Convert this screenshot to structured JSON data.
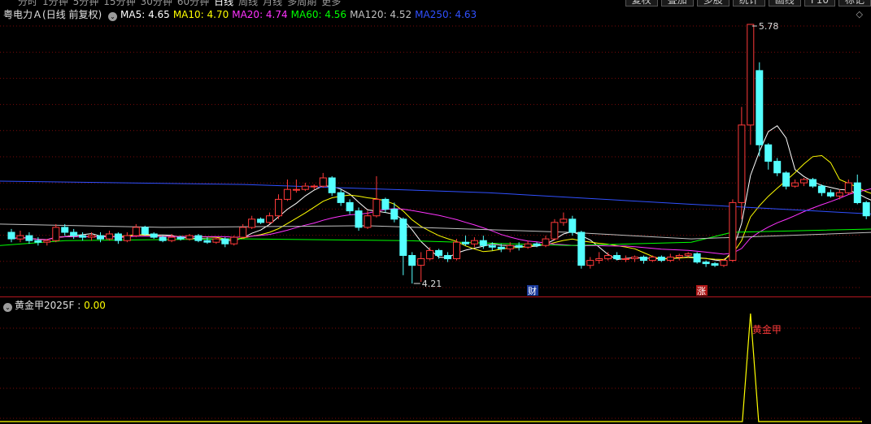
{
  "toolbar": {
    "periods": [
      "分时",
      "1分钟",
      "5分钟",
      "15分钟",
      "30分钟",
      "60分钟",
      "日线",
      "周线",
      "月线",
      "多周期",
      "更多"
    ],
    "buttons": [
      "复权",
      "叠加",
      "多股",
      "统计",
      "画线",
      "F10",
      "标记"
    ]
  },
  "header": {
    "stock_name": "粤电力Ａ",
    "mode": "(日线 前复权)",
    "dropdown_glyph": "⌄",
    "settings_glyph": "◇",
    "ma": [
      {
        "label": "MA5: ",
        "value": "4.65",
        "color": "#ffffff"
      },
      {
        "label": "MA10: ",
        "value": "4.70",
        "color": "#ffff00"
      },
      {
        "label": "MA20: ",
        "value": "4.74",
        "color": "#ff33ff"
      },
      {
        "label": "MA60: ",
        "value": "4.56",
        "color": "#00ff00"
      },
      {
        "label": "MA120: ",
        "value": "4.52",
        "color": "#c0c0c0"
      },
      {
        "label": "MA250: ",
        "value": "4.63",
        "color": "#3050ff"
      }
    ]
  },
  "annotations": {
    "high_label": "5.78",
    "low_label": "4.21",
    "event_cai": "财",
    "event_zhang": "涨"
  },
  "indicator": {
    "dropdown_glyph": "⌄",
    "name": "黄金甲2025F",
    "sep": " : ",
    "value": "0.00",
    "signal_label": "黄金甲"
  },
  "chart_data": {
    "type": "candlestick",
    "price_range": [
      4.21,
      5.78
    ],
    "up_color": "#ff3a3a",
    "down_color": "#54ffff",
    "candles": [
      [
        4.52,
        4.48,
        4.54,
        4.46
      ],
      [
        4.48,
        4.5,
        4.53,
        4.46
      ],
      [
        4.5,
        4.47,
        4.52,
        4.45
      ],
      [
        4.47,
        4.46,
        4.49,
        4.44
      ],
      [
        4.46,
        4.47,
        4.48,
        4.44
      ],
      [
        4.47,
        4.55,
        4.57,
        4.46
      ],
      [
        4.55,
        4.52,
        4.57,
        4.5
      ],
      [
        4.52,
        4.5,
        4.54,
        4.48
      ],
      [
        4.5,
        4.49,
        4.52,
        4.47
      ],
      [
        4.49,
        4.5,
        4.52,
        4.47
      ],
      [
        4.5,
        4.48,
        4.52,
        4.46
      ],
      [
        4.48,
        4.51,
        4.53,
        4.47
      ],
      [
        4.51,
        4.47,
        4.52,
        4.45
      ],
      [
        4.47,
        4.5,
        4.52,
        4.46
      ],
      [
        4.5,
        4.55,
        4.57,
        4.49
      ],
      [
        4.55,
        4.51,
        4.56,
        4.5
      ],
      [
        4.51,
        4.49,
        4.52,
        4.48
      ],
      [
        4.49,
        4.47,
        4.5,
        4.46
      ],
      [
        4.47,
        4.49,
        4.51,
        4.46
      ],
      [
        4.49,
        4.48,
        4.5,
        4.47
      ],
      [
        4.48,
        4.5,
        4.51,
        4.47
      ],
      [
        4.5,
        4.47,
        4.51,
        4.46
      ],
      [
        4.47,
        4.46,
        4.49,
        4.45
      ],
      [
        4.46,
        4.48,
        4.49,
        4.45
      ],
      [
        4.48,
        4.45,
        4.49,
        4.43
      ],
      [
        4.45,
        4.49,
        4.5,
        4.44
      ],
      [
        4.49,
        4.55,
        4.57,
        4.48
      ],
      [
        4.55,
        4.6,
        4.62,
        4.54
      ],
      [
        4.6,
        4.58,
        4.61,
        4.57
      ],
      [
        4.58,
        4.62,
        4.64,
        4.57
      ],
      [
        4.62,
        4.72,
        4.75,
        4.6
      ],
      [
        4.72,
        4.78,
        4.84,
        4.71
      ],
      [
        4.78,
        4.78,
        4.84,
        4.76
      ],
      [
        4.78,
        4.8,
        4.82,
        4.77
      ],
      [
        4.8,
        4.8,
        4.81,
        4.78
      ],
      [
        4.8,
        4.85,
        4.88,
        4.79
      ],
      [
        4.85,
        4.76,
        4.86,
        4.74
      ],
      [
        4.76,
        4.7,
        4.78,
        4.68
      ],
      [
        4.7,
        4.65,
        4.72,
        4.63
      ],
      [
        4.65,
        4.55,
        4.67,
        4.53
      ],
      [
        4.55,
        4.62,
        4.65,
        4.54
      ],
      [
        4.62,
        4.72,
        4.86,
        4.61
      ],
      [
        4.72,
        4.66,
        4.73,
        4.64
      ],
      [
        4.66,
        4.6,
        4.7,
        4.58
      ],
      [
        4.6,
        4.38,
        4.61,
        4.26
      ],
      [
        4.38,
        4.32,
        4.4,
        4.21
      ],
      [
        4.32,
        4.36,
        4.4,
        4.22
      ],
      [
        4.36,
        4.41,
        4.43,
        4.35
      ],
      [
        4.41,
        4.38,
        4.42,
        4.36
      ],
      [
        4.38,
        4.36,
        4.4,
        4.34
      ],
      [
        4.36,
        4.46,
        4.48,
        4.35
      ],
      [
        4.46,
        4.45,
        4.5,
        4.44
      ],
      [
        4.45,
        4.47,
        4.49,
        4.43
      ],
      [
        4.47,
        4.44,
        4.5,
        4.42
      ],
      [
        4.44,
        4.43,
        4.46,
        4.41
      ],
      [
        4.43,
        4.42,
        4.45,
        4.4
      ],
      [
        4.42,
        4.44,
        4.46,
        4.4
      ],
      [
        4.44,
        4.43,
        4.46,
        4.41
      ],
      [
        4.43,
        4.45,
        4.47,
        4.42
      ],
      [
        4.45,
        4.44,
        4.46,
        4.43
      ],
      [
        4.44,
        4.48,
        4.5,
        4.43
      ],
      [
        4.48,
        4.58,
        4.6,
        4.47
      ],
      [
        4.58,
        4.6,
        4.64,
        4.56
      ],
      [
        4.6,
        4.52,
        4.62,
        4.5
      ],
      [
        4.52,
        4.32,
        4.53,
        4.3
      ],
      [
        4.32,
        4.35,
        4.37,
        4.3
      ],
      [
        4.35,
        4.36,
        4.4,
        4.33
      ],
      [
        4.36,
        4.38,
        4.4,
        4.35
      ],
      [
        4.38,
        4.36,
        4.4,
        4.35
      ],
      [
        4.36,
        4.36,
        4.38,
        4.34
      ],
      [
        4.36,
        4.37,
        4.38,
        4.34
      ],
      [
        4.37,
        4.35,
        4.38,
        4.33
      ],
      [
        4.35,
        4.37,
        4.38,
        4.34
      ],
      [
        4.37,
        4.35,
        4.38,
        4.34
      ],
      [
        4.35,
        4.37,
        4.39,
        4.34
      ],
      [
        4.37,
        4.38,
        4.39,
        4.35
      ],
      [
        4.38,
        4.39,
        4.4,
        4.37
      ],
      [
        4.39,
        4.34,
        4.4,
        4.33
      ],
      [
        4.34,
        4.33,
        4.35,
        4.31
      ],
      [
        4.33,
        4.32,
        4.34,
        4.31
      ],
      [
        4.32,
        4.35,
        4.36,
        4.31
      ],
      [
        4.35,
        4.7,
        4.72,
        4.34
      ],
      [
        4.7,
        5.17,
        5.28,
        4.6
      ],
      [
        5.17,
        5.78,
        5.78,
        5.05
      ],
      [
        5.5,
        5.05,
        5.55,
        4.98
      ],
      [
        5.05,
        4.95,
        5.06,
        4.9
      ],
      [
        4.95,
        4.88,
        4.97,
        4.86
      ],
      [
        4.88,
        4.8,
        4.89,
        4.78
      ],
      [
        4.8,
        4.82,
        4.84,
        4.79
      ],
      [
        4.82,
        4.84,
        4.85,
        4.8
      ],
      [
        4.84,
        4.8,
        4.85,
        4.79
      ],
      [
        4.8,
        4.76,
        4.81,
        4.74
      ],
      [
        4.76,
        4.74,
        4.78,
        4.73
      ],
      [
        4.74,
        4.76,
        4.78,
        4.72
      ],
      [
        4.76,
        4.82,
        4.84,
        4.75
      ],
      [
        4.82,
        4.7,
        4.87,
        4.69
      ],
      [
        4.7,
        4.62,
        4.71,
        4.6
      ],
      [
        4.62,
        4.62,
        4.64,
        4.6
      ]
    ],
    "signal_x_index": 83,
    "signal_max": 1
  }
}
